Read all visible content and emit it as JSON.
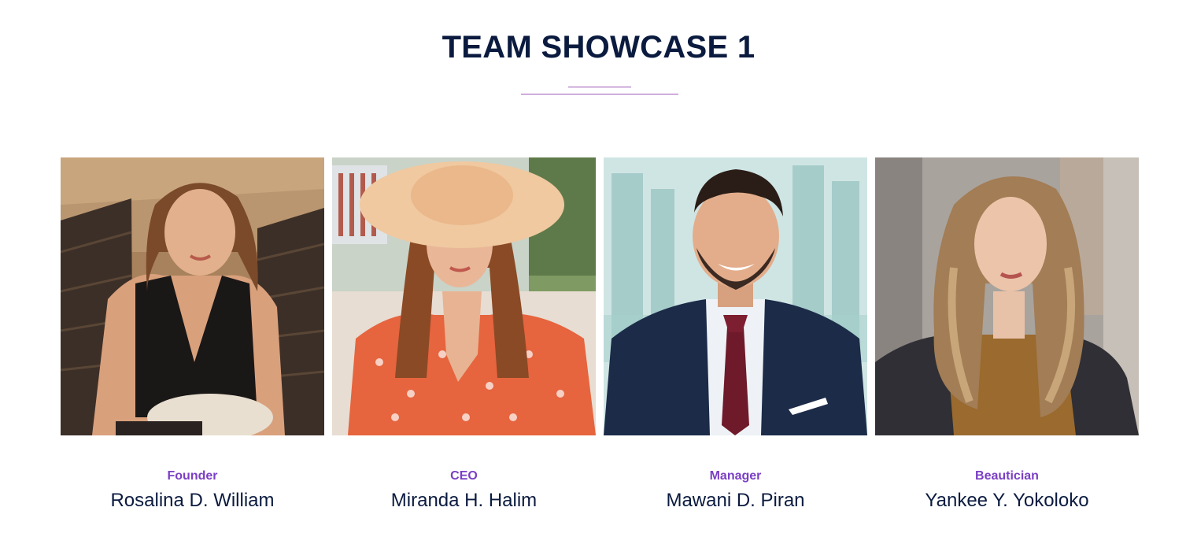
{
  "section": {
    "title": "TEAM SHOWCASE 1"
  },
  "colors": {
    "title": "#0b1b3f",
    "accent": "#7b3fc4",
    "divider": "#9b59b6"
  },
  "members": [
    {
      "role": "Founder",
      "name": "Rosalina D. William",
      "photo": "portrait-woman-black-top"
    },
    {
      "role": "CEO",
      "name": "Miranda H. Halim",
      "photo": "portrait-woman-straw-hat"
    },
    {
      "role": "Manager",
      "name": "Mawani D. Piran",
      "photo": "portrait-man-suit"
    },
    {
      "role": "Beautician",
      "name": "Yankee Y. Yokoloko",
      "photo": "portrait-woman-curly-hair"
    }
  ]
}
